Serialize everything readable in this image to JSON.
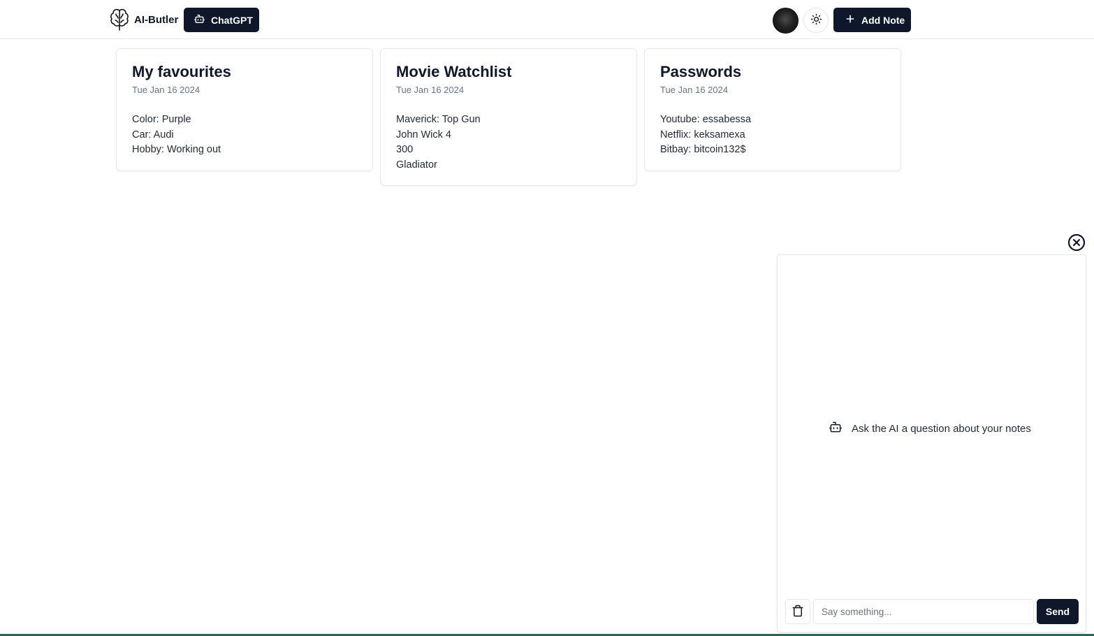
{
  "header": {
    "brand_name": "AI-Butler",
    "chatgpt_label": "ChatGPT",
    "add_note_label": "Add Note"
  },
  "notes": [
    {
      "title": "My favourites",
      "date": "Tue Jan 16 2024",
      "lines": [
        "Color: Purple",
        "Car: Audi",
        "Hobby: Working out"
      ]
    },
    {
      "title": "Movie Watchlist",
      "date": "Tue Jan 16 2024",
      "lines": [
        "Maverick: Top Gun",
        "John Wick 4",
        "300",
        "Gladiator"
      ]
    },
    {
      "title": "Passwords",
      "date": "Tue Jan 16 2024",
      "lines": [
        "Youtube: essabessa",
        "Netflix: keksamexa",
        "Bitbay: bitcoin132$"
      ]
    }
  ],
  "chat": {
    "empty_message": "Ask the AI a question about your notes",
    "input_placeholder": "Say something...",
    "input_value": "",
    "send_label": "Send"
  },
  "icons": {
    "brand": "brain-icon",
    "chatgpt": "bot-icon",
    "theme": "sun-icon",
    "add": "plus-icon",
    "close": "close-circle-icon",
    "empty": "bot-icon",
    "clear": "trash-icon"
  },
  "colors": {
    "primary": "#0f172a",
    "muted_text": "#64748b",
    "border": "#e5e7eb",
    "background": "#ffffff"
  }
}
